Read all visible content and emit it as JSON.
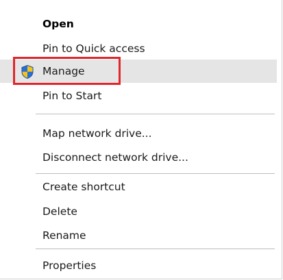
{
  "menu": {
    "items": [
      {
        "label": "Open"
      },
      {
        "label": "Pin to Quick access"
      },
      {
        "label": "Manage",
        "icon": "shield-icon"
      },
      {
        "label": "Pin to Start"
      },
      {
        "label": "Map network drive..."
      },
      {
        "label": "Disconnect network drive..."
      },
      {
        "label": "Create shortcut"
      },
      {
        "label": "Delete"
      },
      {
        "label": "Rename"
      },
      {
        "label": "Properties"
      }
    ]
  },
  "colors": {
    "hover_background": "#e5e5e5",
    "highlight_border": "#e0262b",
    "separator": "#bdbdbd",
    "shield_blue": "#2a6fd6",
    "shield_yellow": "#f2c31a"
  }
}
